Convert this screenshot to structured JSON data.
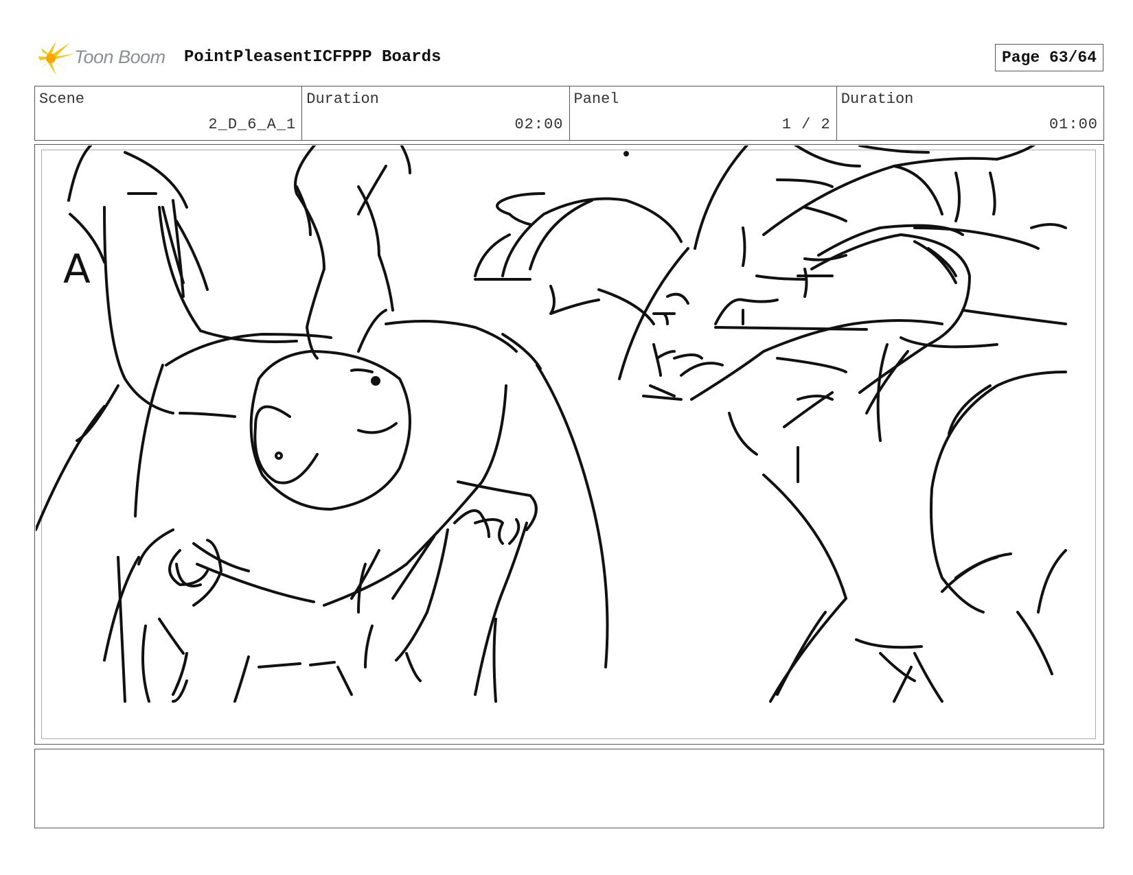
{
  "header": {
    "logo_text": "Toon Boom",
    "board_title": "PointPleasentICFPPP Boards",
    "page_label": "Page 63/64"
  },
  "info": {
    "scene_label": "Scene",
    "scene_value": "2_D_6_A_1",
    "scene_duration_label": "Duration",
    "scene_duration_value": "02:00",
    "panel_label": "Panel",
    "panel_value": "1 / 2",
    "panel_duration_label": "Duration",
    "panel_duration_value": "01:00"
  },
  "panel": {
    "sketch_note": "A"
  },
  "notes": {
    "text": ""
  },
  "colors": {
    "logo_accent": "#f5c518",
    "border": "#555555",
    "ink": "#111111"
  }
}
